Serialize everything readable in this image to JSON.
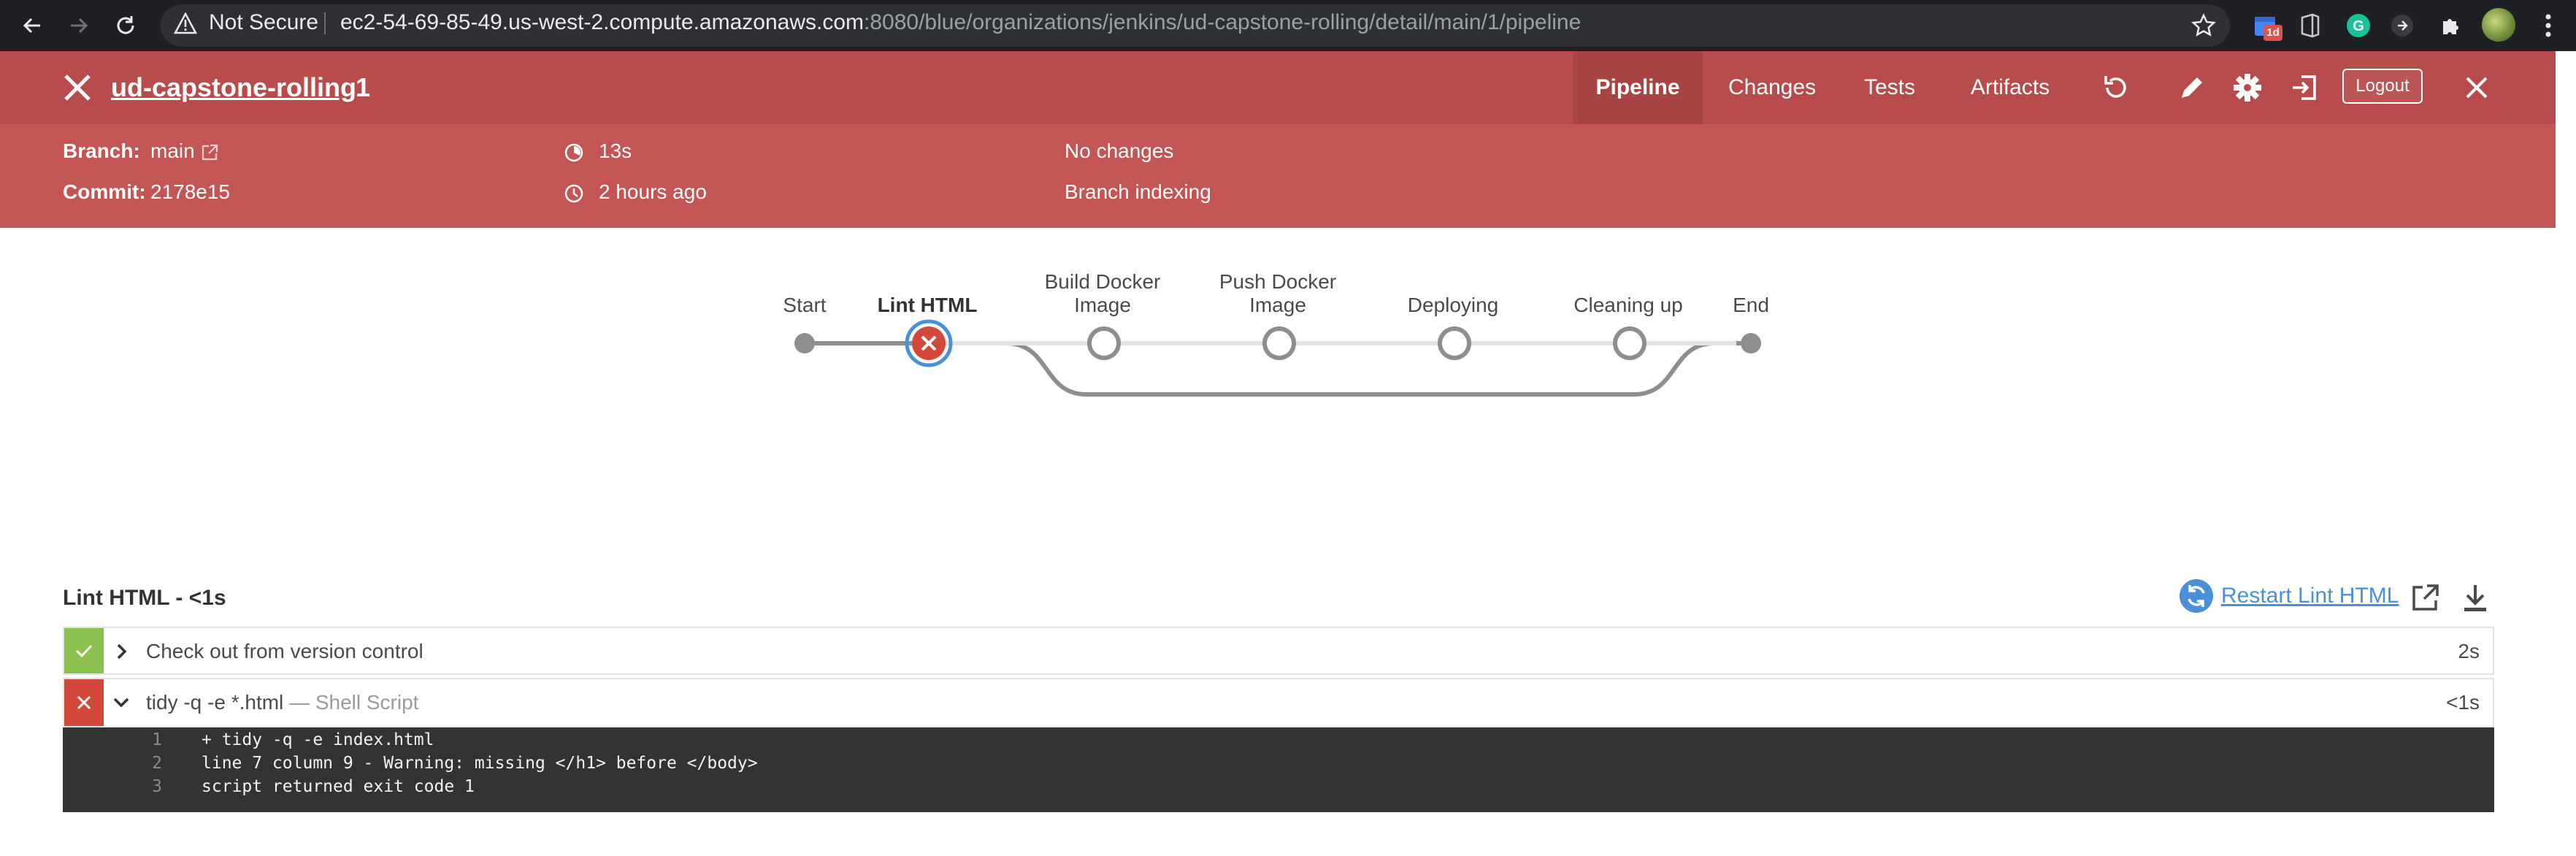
{
  "browser": {
    "security_label": "Not Secure",
    "url_host": "ec2-54-69-85-49.us-west-2.compute.amazonaws.com",
    "url_path": ":8080/blue/organizations/jenkins/ud-capstone-rolling/detail/main/1/pipeline",
    "extension_badge": "1d"
  },
  "header": {
    "job_name": "ud-capstone-rolling",
    "run_number": "1",
    "tabs": [
      {
        "label": "Pipeline",
        "active": true
      },
      {
        "label": "Changes",
        "active": false
      },
      {
        "label": "Tests",
        "active": false
      },
      {
        "label": "Artifacts",
        "active": false
      }
    ],
    "logout_label": "Logout",
    "colors": {
      "failure_red": "#c45555",
      "header_dark": "#b84b4b"
    }
  },
  "run_info": {
    "branch_label": "Branch:",
    "branch_value": "main",
    "commit_label": "Commit:",
    "commit_value": "2178e15",
    "duration": "13s",
    "time_ago": "2 hours ago",
    "changes": "No changes",
    "cause": "Branch indexing"
  },
  "pipeline": {
    "stages": [
      {
        "label": "Start",
        "status": "start"
      },
      {
        "label": "Lint HTML",
        "status": "failed",
        "selected": true
      },
      {
        "label": "Build Docker Image",
        "status": "not_built"
      },
      {
        "label": "Push Docker Image",
        "status": "not_built"
      },
      {
        "label": "Deploying",
        "status": "not_built"
      },
      {
        "label": "Cleaning up",
        "status": "not_built"
      },
      {
        "label": "End",
        "status": "end"
      }
    ]
  },
  "stage_detail": {
    "title": "Lint HTML - <1s",
    "restart_label": "Restart Lint HTML",
    "steps": [
      {
        "label": "Check out from version control",
        "sublabel": "",
        "duration": "2s",
        "status": "success",
        "expanded": false
      },
      {
        "label": "tidy -q -e *.html",
        "sublabel": "— Shell Script",
        "duration": "<1s",
        "status": "failure",
        "expanded": true
      }
    ],
    "log": [
      {
        "num": "1",
        "text": "+ tidy -q -e index.html"
      },
      {
        "num": "2",
        "text": "line 7 column 9 - Warning: missing </h1> before </body>"
      },
      {
        "num": "3",
        "text": "script returned exit code 1"
      }
    ],
    "colors": {
      "success": "#8cc04f",
      "failure": "#d24939",
      "link": "#4a90d9"
    }
  }
}
